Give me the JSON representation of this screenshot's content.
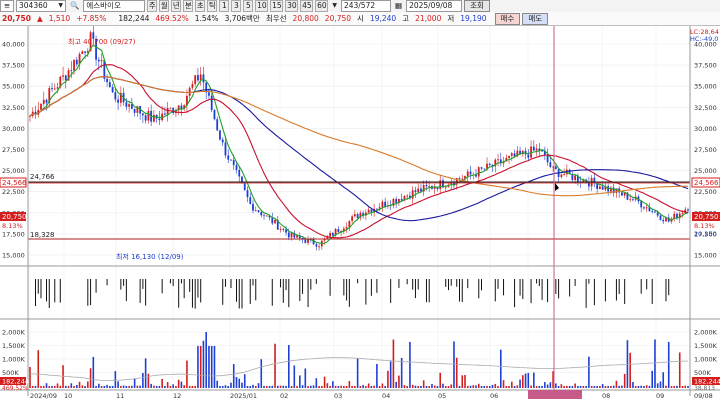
{
  "toolbar": {
    "code": "304360",
    "name": "에스바이오",
    "period_tabs": [
      "주",
      "월",
      "년",
      "분",
      "초",
      "틱"
    ],
    "interval_tabs": [
      "1",
      "3",
      "5",
      "10",
      "15",
      "30",
      "45",
      "60"
    ],
    "count": "243/572",
    "date": "2025/09/08",
    "query_label": "조회"
  },
  "quote": {
    "price": "20,750",
    "change": "1,510",
    "change_pct": "+7.85%",
    "volume": "182,244",
    "volume_pct": "469.52%",
    "turnover": "1.54%",
    "amount": "3,706백만",
    "prev_label": "최우선",
    "prev": "20,800",
    "bid": "20,750",
    "open_label": "시",
    "open": "19,240",
    "high_label": "고",
    "high": "21,000",
    "low_label": "저",
    "low": "19,190",
    "buy_label": "매수",
    "sell_label": "매도"
  },
  "chart": {
    "price_ticks": [
      "40,000",
      "37,500",
      "35,000",
      "32,500",
      "30,000",
      "27,500",
      "25,000",
      "22,500",
      "20,000",
      "17,500",
      "15,000"
    ],
    "volume_ticks": [
      "2,000K",
      "1,500K",
      "1,000K",
      "500K"
    ],
    "month_labels": [
      "2024/09",
      "10",
      "11",
      "12",
      "2025/01",
      "02",
      "03",
      "04",
      "05",
      "06",
      "2025/07/08(화)",
      "08",
      "09"
    ],
    "hline_upper": "24,766",
    "hline_lower": "18,328",
    "right_upper": "24,566",
    "right_price": "20,750",
    "right_price2": "20,250",
    "left_price": "20,750",
    "left_pct": "8.13%",
    "right_pct": "8.13%",
    "max_label": "최고 40,700 (09/27)",
    "min_label": "최저 16,130 (12/09)",
    "lc_label": "LC:28,64",
    "hc_label": "HC:-49,0",
    "vol_left": "182,244",
    "vol_left_pct": "469.52%",
    "vol_right": "182,244",
    "vol_right2": "38,813",
    "right_bottom_date": "09/08"
  },
  "colors": {
    "up": "#d41e1e",
    "down": "#1e3fd4",
    "ma5": "#22a02a",
    "ma20": "#c8102e",
    "ma60": "#1a1aa0",
    "ma120": "#d87a2a"
  }
}
